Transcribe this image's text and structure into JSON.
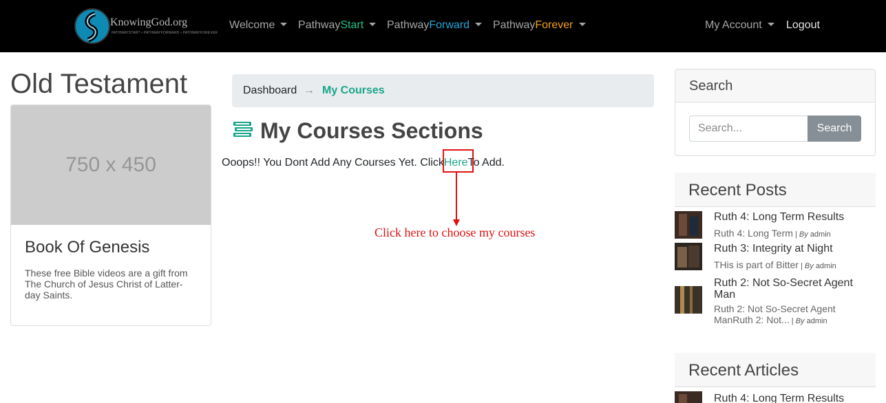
{
  "brand": {
    "logo_text": "KnowingGod.org",
    "logo_subtext": "PATHWAYSTART • PATHWAYFORWARD • PATHWAYFOREVER"
  },
  "nav": {
    "welcome": "Welcome",
    "pathway_prefix": "Pathway",
    "start": "Start",
    "forward": "Forward",
    "forever": "Forever",
    "my_account": "My Account",
    "logout": "Logout"
  },
  "left": {
    "title": "Old Testament",
    "card": {
      "image_placeholder": "750 x 450",
      "title": "Book Of Genesis",
      "text": "These free Bible videos are a gift from The Church of Jesus Christ of Latter-day Saints."
    }
  },
  "breadcrumb": {
    "dashboard": "Dashboard",
    "separator": "→",
    "current": "My Courses"
  },
  "main": {
    "section_title": "My Courses Sections",
    "message_prefix": "Ooops!! You Dont Add Any Courses Yet. Click",
    "message_link": "Here",
    "message_suffix": "To Add.",
    "annotation": "Click here to choose my courses"
  },
  "sidebar": {
    "search": {
      "heading": "Search",
      "placeholder": "Search...",
      "button": "Search"
    },
    "recent_posts": {
      "heading": "Recent Posts",
      "items": [
        {
          "title": "Ruth 4: Long Term Results",
          "excerpt": "Ruth 4: Long Term",
          "by": "By",
          "author": "admin"
        },
        {
          "title": "Ruth 3: Integrity at Night",
          "excerpt": "THis is part of Bitter",
          "by": "By",
          "author": "admin"
        },
        {
          "title": "Ruth 2: Not So-Secret Agent Man",
          "excerpt": "Ruth 2: Not So-Secret Agent ManRuth 2: Not...",
          "by": "By",
          "author": "admin"
        }
      ]
    },
    "recent_articles": {
      "heading": "Recent Articles",
      "items": [
        {
          "title": "Ruth 4: Long Term Results"
        }
      ]
    }
  },
  "colors": {
    "accent_green": "#17a589",
    "start": "#1fbf8f",
    "forward": "#23a8d8",
    "forever": "#f0a31c",
    "annotation_red": "#e01010"
  }
}
